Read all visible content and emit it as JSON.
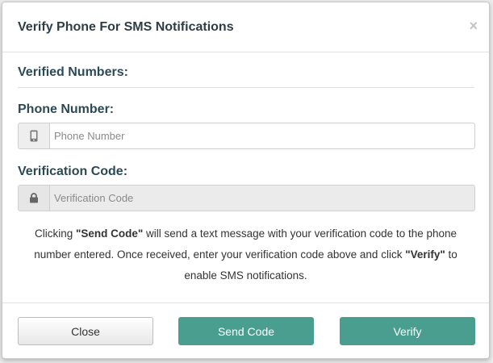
{
  "modal": {
    "title": "Verify Phone For SMS Notifications",
    "close_symbol": "×",
    "close_icon": "close-icon"
  },
  "verified": {
    "label": "Verified Numbers:"
  },
  "phone": {
    "label": "Phone Number:",
    "placeholder": "Phone Number",
    "value": "",
    "icon": "mobile-phone-icon"
  },
  "code": {
    "label": "Verification Code:",
    "placeholder": "Verification Code",
    "value": "",
    "disabled": true,
    "icon": "lock-icon"
  },
  "info": {
    "part1": "Clicking ",
    "send_code_bold": "\"Send Code\"",
    "part2": " will send a text message with your verification code to the phone number entered. Once received, enter your verification code above and click ",
    "verify_bold": "\"Verify\"",
    "part3": " to enable SMS notifications."
  },
  "footer": {
    "close_label": "Close",
    "send_label": "Send Code",
    "verify_label": "Verify"
  },
  "colors": {
    "primary": "#4a9e90",
    "heading": "#2c4a55"
  }
}
